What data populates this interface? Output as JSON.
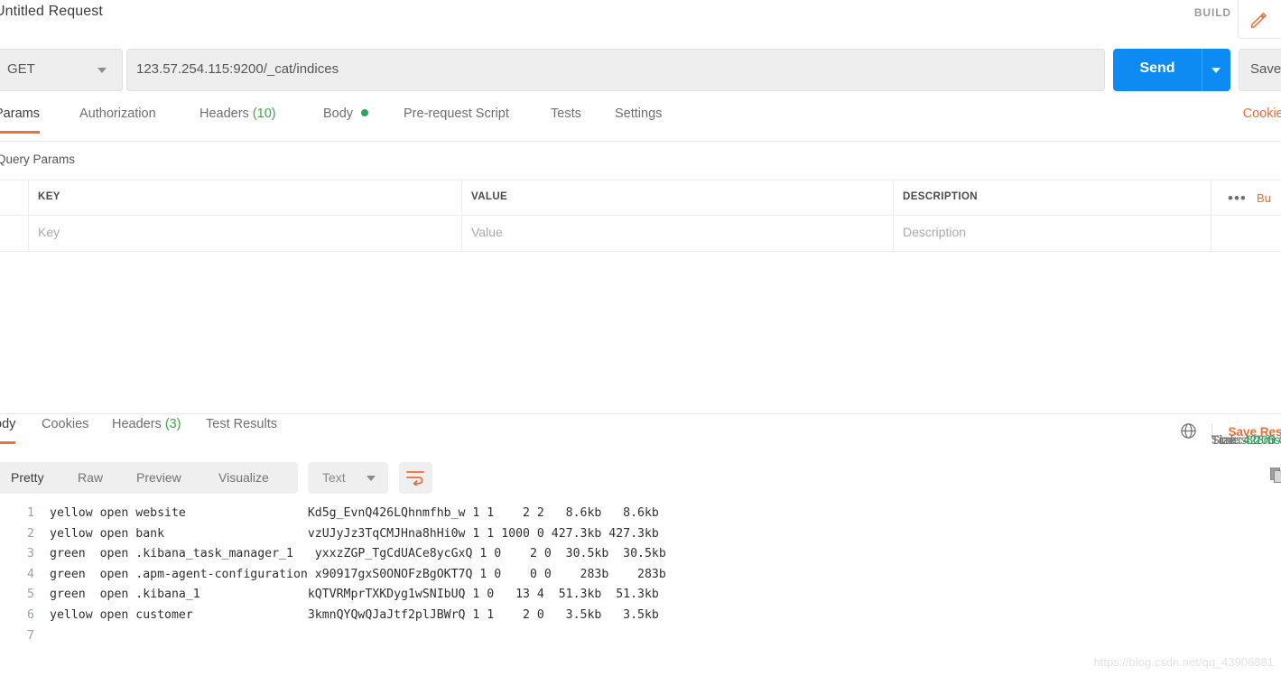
{
  "titlebar": {
    "request_title": "Untitled Request",
    "build_label": "BUILD",
    "edit_icon": "pencil-icon"
  },
  "urlbar": {
    "method": "GET",
    "method_caret": "chevron-down-icon",
    "url": "123.57.254.115:9200/_cat/indices",
    "send_label": "Send",
    "send_caret": "chevron-down-icon",
    "save_label": "Save"
  },
  "request_tabs": [
    {
      "label": "Params",
      "active": true
    },
    {
      "label": "Authorization",
      "active": false
    },
    {
      "label": "Headers",
      "count": "(10)",
      "active": false
    },
    {
      "label": "Body",
      "dot": true,
      "active": false
    },
    {
      "label": "Pre-request Script",
      "active": false
    },
    {
      "label": "Tests",
      "active": false
    },
    {
      "label": "Settings",
      "active": false
    }
  ],
  "cookies_link": "Cookies",
  "query_params": {
    "section_title": "Query Params",
    "headers": {
      "key": "KEY",
      "value": "VALUE",
      "description": "DESCRIPTION"
    },
    "menu_icon": "ellipsis-icon",
    "bulk_edit_label": "Bu",
    "placeholders": {
      "key": "Key",
      "value": "Value",
      "description": "Description"
    }
  },
  "response_tabs": [
    {
      "label": "ody",
      "active": true
    },
    {
      "label": "Cookies",
      "active": false
    },
    {
      "label": "Headers",
      "count": "(3)",
      "active": false
    },
    {
      "label": "Test Results",
      "active": false
    }
  ],
  "status": {
    "globe_icon": "globe-icon",
    "status_label": "Status:",
    "status_value": "200 OK",
    "time_label": "Time:",
    "time_value": "80 ms",
    "size_label": "Size:",
    "size_value": "428 B",
    "save_response": "Save Respo"
  },
  "body_toolbar": {
    "views": [
      {
        "label": "Pretty",
        "active": true
      },
      {
        "label": "Raw",
        "active": false
      },
      {
        "label": "Preview",
        "active": false
      },
      {
        "label": "Visualize",
        "active": false
      }
    ],
    "language": "Text",
    "language_caret": "chevron-down-icon",
    "wrap_icon": "word-wrap-icon",
    "copy_icon": "copy-icon"
  },
  "response_body": {
    "lines": [
      {
        "num": "1",
        "text": "yellow open website                 Kd5g_EvnQ426LQhnmfhb_w 1 1    2 2   8.6kb   8.6kb"
      },
      {
        "num": "2",
        "text": "yellow open bank                    vzUJyJz3TqCMJHna8hHi0w 1 1 1000 0 427.3kb 427.3kb"
      },
      {
        "num": "3",
        "text": "green  open .kibana_task_manager_1   yxxzZGP_TgCdUACe8ycGxQ 1 0    2 0  30.5kb  30.5kb"
      },
      {
        "num": "4",
        "text": "green  open .apm-agent-configuration x90917gxS0ONOFzBgOKT7Q 1 0    0 0    283b    283b"
      },
      {
        "num": "5",
        "text": "green  open .kibana_1               kQTVRMprTXKDyg1wSNIbUQ 1 0   13 4  51.3kb  51.3kb"
      },
      {
        "num": "6",
        "text": "yellow open customer                3kmnQYQwQJaJtf2plJBWrQ 1 1    2 0   3.5kb   3.5kb"
      },
      {
        "num": "7",
        "text": ""
      }
    ]
  },
  "watermark": "https://blog.csdn.net/qq_43906881",
  "colors": {
    "accent_orange": "#f26b3a",
    "send_blue": "#0d8bf2",
    "status_green": "#26a65b"
  }
}
